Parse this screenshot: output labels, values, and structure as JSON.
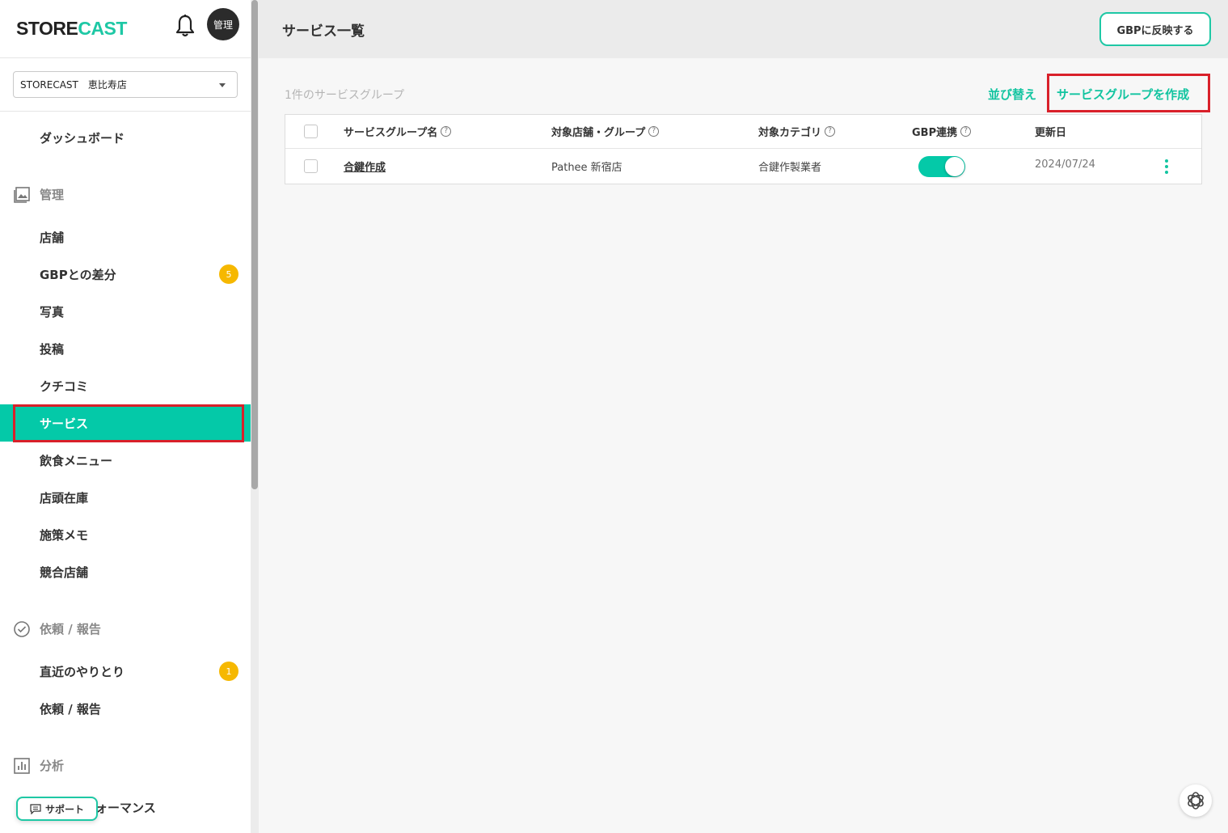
{
  "sidebar": {
    "logo_part1": "STORE",
    "logo_part2": "CAST",
    "avatar_label": "管理",
    "store_select": "STORECAST　恵比寿店",
    "dashboard": "ダッシュボード",
    "section_manage": "管理",
    "items_manage": [
      {
        "label": "店舗"
      },
      {
        "label": "GBPとの差分",
        "badge": "5"
      },
      {
        "label": "写真"
      },
      {
        "label": "投稿"
      },
      {
        "label": "クチコミ"
      },
      {
        "label": "サービス"
      },
      {
        "label": "飲食メニュー"
      },
      {
        "label": "店頭在庫"
      },
      {
        "label": "施策メモ"
      },
      {
        "label": "競合店舗"
      }
    ],
    "section_request": "依頼 / 報告",
    "items_request": [
      {
        "label": "直近のやりとり",
        "badge": "1"
      },
      {
        "label": "依頼 / 報告"
      }
    ],
    "section_analysis": "分析",
    "partial_item": "ォーマンス",
    "support_label": "サポート"
  },
  "header": {
    "title": "サービス一覧",
    "gbp_button": "GBPに反映する"
  },
  "main": {
    "count_label": "1件のサービスグループ",
    "sort_label": "並び替え",
    "create_label": "サービスグループを作成",
    "columns": [
      "サービスグループ名",
      "対象店舗・グループ",
      "対象カテゴリ",
      "GBP連携",
      "更新日"
    ],
    "help_glyph": "?",
    "rows": [
      {
        "name": "合鍵作成",
        "store": "Pathee 新宿店",
        "category": "合鍵作製業者",
        "gbp_enabled": true,
        "updated": "2024/07/24"
      }
    ]
  },
  "colors": {
    "accent": "#04c9a8",
    "highlight": "#d9202a",
    "badge": "#f6b800"
  }
}
